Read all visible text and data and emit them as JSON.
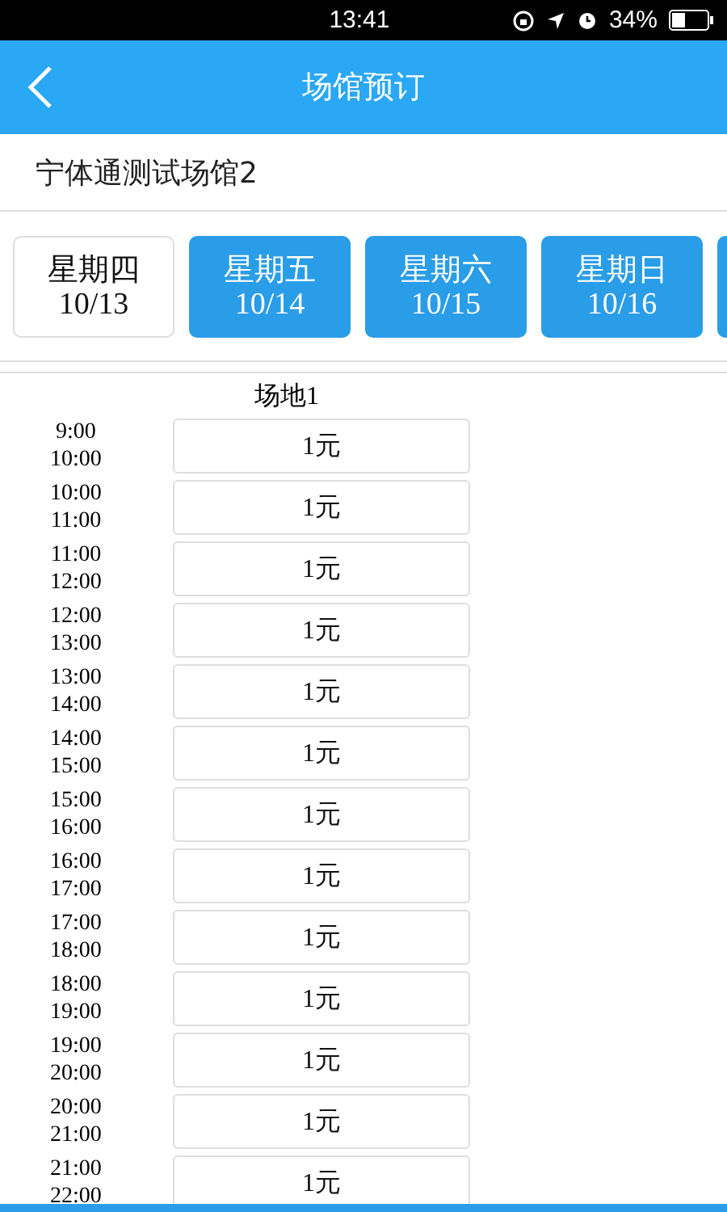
{
  "status_bar": {
    "time": "13:41",
    "battery": "34%"
  },
  "header": {
    "title": "场馆预订"
  },
  "venue": {
    "name": "宁体通测试场馆2"
  },
  "days": [
    {
      "weekday": "星期四",
      "date": "10/13",
      "selected": true
    },
    {
      "weekday": "星期五",
      "date": "10/14",
      "selected": false
    },
    {
      "weekday": "星期六",
      "date": "10/15",
      "selected": false
    },
    {
      "weekday": "星期日",
      "date": "10/16",
      "selected": false
    },
    {
      "selected": false
    }
  ],
  "court": {
    "name": "场地1"
  },
  "slots": [
    {
      "start": "9:00",
      "end": "10:00",
      "price": "1元"
    },
    {
      "start": "10:00",
      "end": "11:00",
      "price": "1元"
    },
    {
      "start": "11:00",
      "end": "12:00",
      "price": "1元"
    },
    {
      "start": "12:00",
      "end": "13:00",
      "price": "1元"
    },
    {
      "start": "13:00",
      "end": "14:00",
      "price": "1元"
    },
    {
      "start": "14:00",
      "end": "15:00",
      "price": "1元"
    },
    {
      "start": "15:00",
      "end": "16:00",
      "price": "1元"
    },
    {
      "start": "16:00",
      "end": "17:00",
      "price": "1元"
    },
    {
      "start": "17:00",
      "end": "18:00",
      "price": "1元"
    },
    {
      "start": "18:00",
      "end": "19:00",
      "price": "1元"
    },
    {
      "start": "19:00",
      "end": "20:00",
      "price": "1元"
    },
    {
      "start": "20:00",
      "end": "21:00",
      "price": "1元"
    },
    {
      "start": "21:00",
      "end": "22:00",
      "price": "1元"
    }
  ]
}
